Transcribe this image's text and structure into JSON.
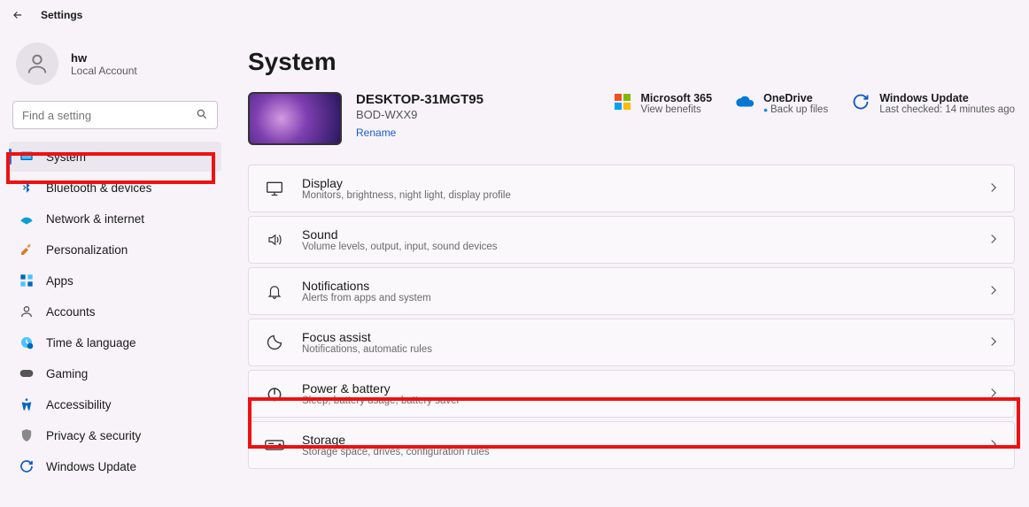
{
  "app_title": "Settings",
  "user": {
    "name": "hw",
    "sub": "Local Account"
  },
  "search": {
    "placeholder": "Find a setting"
  },
  "nav": [
    {
      "key": "system",
      "label": "System",
      "selected": true
    },
    {
      "key": "bluetooth",
      "label": "Bluetooth & devices"
    },
    {
      "key": "network",
      "label": "Network & internet"
    },
    {
      "key": "personalization",
      "label": "Personalization"
    },
    {
      "key": "apps",
      "label": "Apps"
    },
    {
      "key": "accounts",
      "label": "Accounts"
    },
    {
      "key": "time",
      "label": "Time & language"
    },
    {
      "key": "gaming",
      "label": "Gaming"
    },
    {
      "key": "accessibility",
      "label": "Accessibility"
    },
    {
      "key": "privacy",
      "label": "Privacy & security"
    },
    {
      "key": "update",
      "label": "Windows Update"
    }
  ],
  "page": {
    "title": "System"
  },
  "device": {
    "name": "DESKTOP-31MGT95",
    "model": "BOD-WXX9",
    "rename": "Rename"
  },
  "tiles": {
    "ms365": {
      "title": "Microsoft 365",
      "sub": "View benefits"
    },
    "onedrive": {
      "title": "OneDrive",
      "sub": "Back up files"
    },
    "update": {
      "title": "Windows Update",
      "sub": "Last checked: 14 minutes ago"
    }
  },
  "cards": [
    {
      "key": "display",
      "title": "Display",
      "sub": "Monitors, brightness, night light, display profile"
    },
    {
      "key": "sound",
      "title": "Sound",
      "sub": "Volume levels, output, input, sound devices"
    },
    {
      "key": "notifications",
      "title": "Notifications",
      "sub": "Alerts from apps and system"
    },
    {
      "key": "focus",
      "title": "Focus assist",
      "sub": "Notifications, automatic rules"
    },
    {
      "key": "power",
      "title": "Power & battery",
      "sub": "Sleep, battery usage, battery saver"
    },
    {
      "key": "storage",
      "title": "Storage",
      "sub": "Storage space, drives, configuration rules"
    }
  ]
}
